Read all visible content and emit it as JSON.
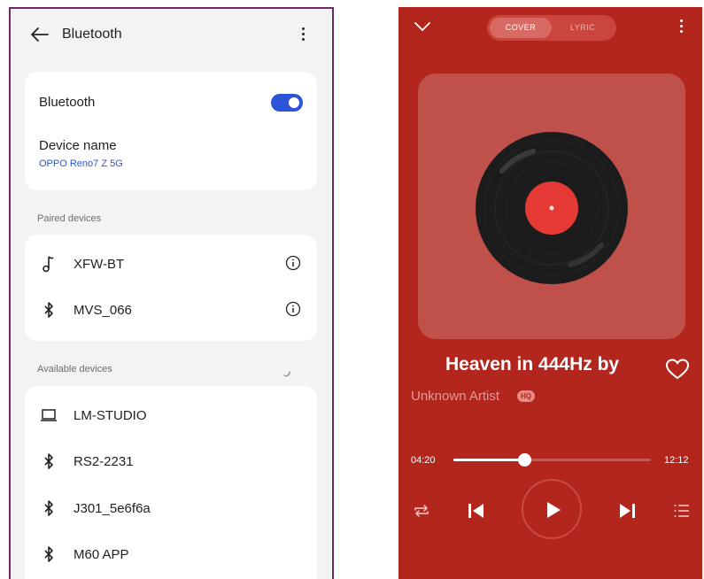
{
  "settings": {
    "header": {
      "title": "Bluetooth"
    },
    "main_card": {
      "bluetooth_label": "Bluetooth",
      "bluetooth_on": true,
      "device_name_label": "Device name",
      "device_name_value": "OPPO Reno7 Z 5G"
    },
    "paired_section": {
      "label": "Paired devices",
      "devices": [
        {
          "name": "XFW-BT",
          "icon": "music-note-icon"
        },
        {
          "name": "MVS_066",
          "icon": "bluetooth-icon"
        }
      ]
    },
    "available_section": {
      "label": "Available devices",
      "devices": [
        {
          "name": "LM-STUDIO",
          "icon": "laptop-icon"
        },
        {
          "name": "RS2-2231",
          "icon": "bluetooth-icon"
        },
        {
          "name": "J301_5e6f6a",
          "icon": "bluetooth-icon"
        },
        {
          "name": "M60 APP",
          "icon": "bluetooth-icon"
        }
      ]
    },
    "colors": {
      "accent": "#2d54d6",
      "link": "#2c55c9"
    }
  },
  "player": {
    "tabs": {
      "cover": "COVER",
      "lyric": "LYRIC",
      "selected": "COVER"
    },
    "song_title": "Heaven in 444Hz by",
    "artist": "Unknown Artist",
    "badge": "HQ",
    "progress": {
      "elapsed": "04:20",
      "total": "12:12",
      "fraction": 0.36
    },
    "controls": [
      "repeat-icon",
      "previous-icon",
      "play-icon",
      "next-icon",
      "queue-icon"
    ],
    "colors": {
      "background": "#b3261e",
      "record_label": "#e53935"
    }
  }
}
